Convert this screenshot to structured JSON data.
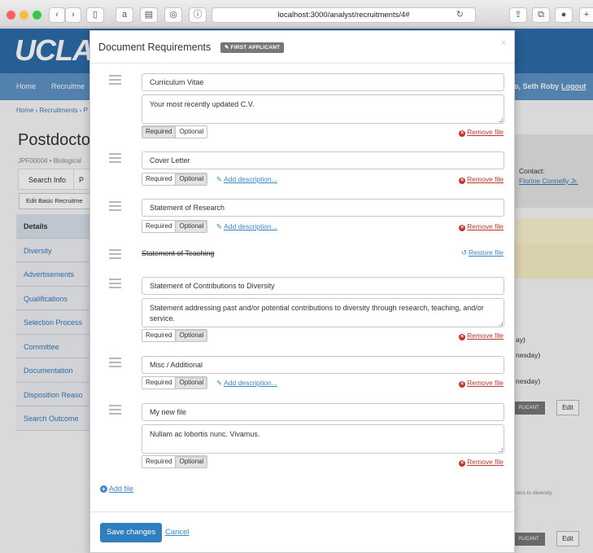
{
  "browser": {
    "url": "localhost:3000/analyst/recruitments/4#"
  },
  "background": {
    "logo": "UCLA",
    "nav": [
      "Home",
      "Recruitme",
      "o, Seth Roby",
      "Logout"
    ],
    "breadcrumb": "Home › Recruitments › P",
    "title": "Postdocto",
    "subtitle": "JPF00004 • Biological",
    "tabs": [
      "Search Info",
      "P"
    ],
    "edit_basic": "Edit Basic Recruitme",
    "sidebar": [
      {
        "label": "Details"
      },
      {
        "label": "Diversity"
      },
      {
        "label": "Advertisements"
      },
      {
        "label": "Qualifications"
      },
      {
        "label": "Selection Process"
      },
      {
        "label": "Committee"
      },
      {
        "label": "Documentation"
      },
      {
        "label": "Disposition Reaso"
      },
      {
        "label": "Search Outcome"
      }
    ],
    "contact_label": "Contact:",
    "contact_name": "Florine Connelly Jr.",
    "right_texts": [
      "ay)",
      "nesday)",
      "nesday)",
      "ions to diversity"
    ],
    "badge": "PLICANT",
    "edit": "Edit"
  },
  "modal": {
    "title": "Document Requirements",
    "badge": "FIRST APPLICANT",
    "close": "×",
    "required_label": "Required",
    "optional_label": "Optional",
    "add_description": "Add description...",
    "remove_file": "Remove file",
    "restore_file": "Restore file",
    "documents": [
      {
        "name": "Curriculum Vitae",
        "description": "Your most recently updated C.V.",
        "selected": "required"
      },
      {
        "name": "Cover Letter",
        "selected": "optional"
      },
      {
        "name": "Statement of Research",
        "selected": "optional"
      },
      {
        "name": "Statement of Teaching",
        "removed": true
      },
      {
        "name": "Statement of Contributions to Diversity",
        "description": "Statement addressing past and/or potential contributions to diversity through research, teaching, and/or service.",
        "selected": "optional"
      },
      {
        "name": "Misc / Additional",
        "selected": "optional"
      },
      {
        "name": "My new file",
        "description": "Nullam ac lobortis nunc. Vivamus.",
        "selected": "optional"
      }
    ],
    "add_file": "Add file",
    "save": "Save changes",
    "cancel": "Cancel"
  }
}
